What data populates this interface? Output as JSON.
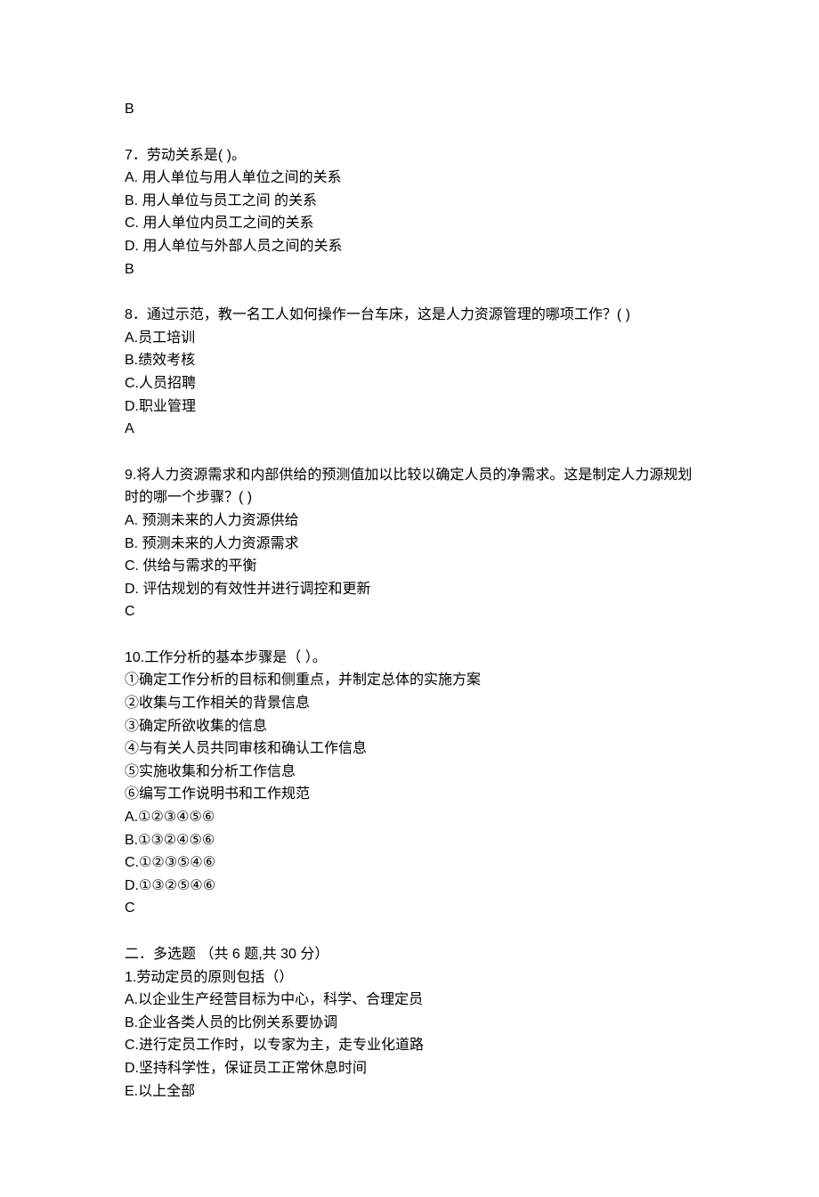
{
  "orphan_answer": "B",
  "q7": {
    "stem": "7．劳动关系是( )。",
    "a": "A. 用人单位与用人单位之间的关系",
    "b": "B. 用人单位与员工之间 的关系",
    "c": "C. 用人单位内员工之间的关系",
    "d": "D. 用人单位与外部人员之间的关系",
    "answer": "B"
  },
  "q8": {
    "stem": "8．通过示范，教一名工人如何操作一台车床，这是人力资源管理的哪项工作？( )",
    "a": "A.员工培训",
    "b": "B.绩效考核",
    "c": "C.人员招聘",
    "d": "D.职业管理",
    "answer": "A"
  },
  "q9": {
    "stem_l1": "9.将人力资源需求和内部供给的预测值加以比较以确定人员的净需求。这是制定人力源规划",
    "stem_l2": "时的哪一个步骤？( )",
    "a": "A. 预测未来的人力资源供给",
    "b": "B. 预测未来的人力资源需求",
    "c": "C. 供给与需求的平衡",
    "d": "D. 评估规划的有效性并进行调控和更新",
    "answer": "C"
  },
  "q10": {
    "stem": "10.工作分析的基本步骤是（ ）。",
    "s1": "①确定工作分析的目标和侧重点，并制定总体的实施方案",
    "s2": "②收集与工作相关的背景信息",
    "s3": "③确定所欲收集的信息",
    "s4": "④与有关人员共同审核和确认工作信息",
    "s5": "⑤实施收集和分析工作信息",
    "s6": "⑥编写工作说明书和工作规范",
    "a": "A.①②③④⑤⑥",
    "b": "B.①③②④⑤⑥",
    "c": "C.①②③⑤④⑥",
    "d": "D.①③②⑤④⑥",
    "answer": "C"
  },
  "section2": {
    "header": "二．多选题 （共 6 题,共 30 分）"
  },
  "mq1": {
    "stem": "1.劳动定员的原则包括（）",
    "a": "A.以企业生产经营目标为中心，科学、合理定员",
    "b": "B.企业各类人员的比例关系要协调",
    "c": "C.进行定员工作时，以专家为主，走专业化道路",
    "d": "D.坚持科学性，保证员工正常休息时间",
    "e": "E.以上全部"
  }
}
